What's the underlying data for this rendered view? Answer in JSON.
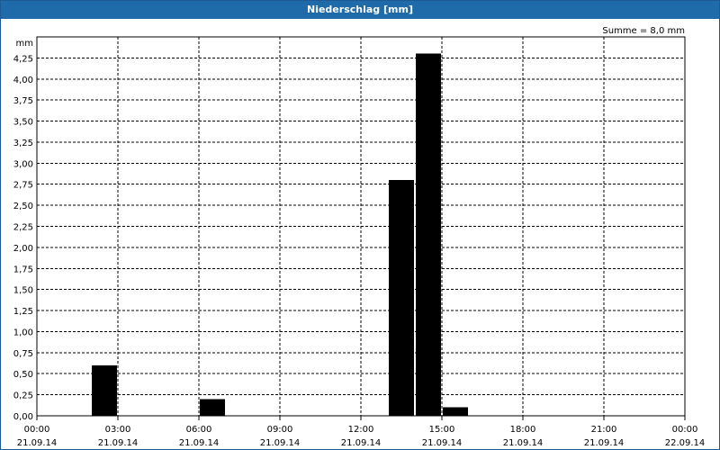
{
  "window": {
    "title": "Niederschlag [mm]"
  },
  "chart_data": {
    "type": "bar",
    "title": "Niederschlag [mm]",
    "ylabel": "mm",
    "annotation": "Summe = 8,0 mm",
    "ylim": [
      0,
      4.5
    ],
    "yticks": [
      {
        "v": 0,
        "label": "0,00"
      },
      {
        "v": 0.25,
        "label": "0,25"
      },
      {
        "v": 0.5,
        "label": "0,50"
      },
      {
        "v": 0.75,
        "label": "0,75"
      },
      {
        "v": 1.0,
        "label": "1,00"
      },
      {
        "v": 1.25,
        "label": "1,25"
      },
      {
        "v": 1.5,
        "label": "1,50"
      },
      {
        "v": 1.75,
        "label": "1,75"
      },
      {
        "v": 2.0,
        "label": "2,00"
      },
      {
        "v": 2.25,
        "label": "2,25"
      },
      {
        "v": 2.5,
        "label": "2,50"
      },
      {
        "v": 2.75,
        "label": "2,75"
      },
      {
        "v": 3.0,
        "label": "3,00"
      },
      {
        "v": 3.25,
        "label": "3,25"
      },
      {
        "v": 3.5,
        "label": "3,50"
      },
      {
        "v": 3.75,
        "label": "3,75"
      },
      {
        "v": 4.0,
        "label": "4,00"
      },
      {
        "v": 4.25,
        "label": "4,25"
      }
    ],
    "xticks": [
      {
        "time": "00:00",
        "date": "21.09.14"
      },
      {
        "time": "03:00",
        "date": "21.09.14"
      },
      {
        "time": "06:00",
        "date": "21.09.14"
      },
      {
        "time": "09:00",
        "date": "21.09.14"
      },
      {
        "time": "12:00",
        "date": "21.09.14"
      },
      {
        "time": "15:00",
        "date": "21.09.14"
      },
      {
        "time": "18:00",
        "date": "21.09.14"
      },
      {
        "time": "21:00",
        "date": "21.09.14"
      },
      {
        "time": "00:00",
        "date": "22.09.14"
      }
    ],
    "xlim": [
      "21.09.14 00:00",
      "22.09.14 00:00"
    ],
    "bars": [
      {
        "start": "02:00",
        "end": "03:00",
        "value": 0.6
      },
      {
        "start": "06:00",
        "end": "07:00",
        "value": 0.2
      },
      {
        "start": "13:00",
        "end": "14:00",
        "value": 2.8
      },
      {
        "start": "14:00",
        "end": "15:00",
        "value": 4.3
      },
      {
        "start": "15:00",
        "end": "16:00",
        "value": 0.1
      }
    ],
    "bar_color": "#000000",
    "grid": true
  }
}
